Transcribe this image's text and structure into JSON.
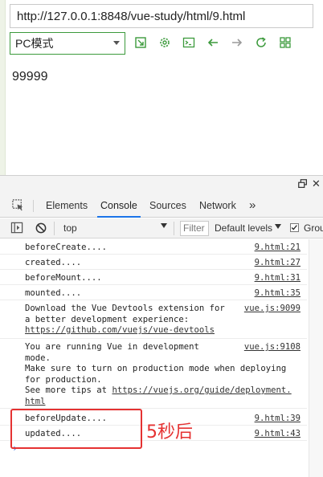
{
  "browser": {
    "url": "http://127.0.0.1:8848/vue-study/html/9.html",
    "mode_select": "PC模式",
    "toolbar_icons": [
      "screenshot-icon",
      "settings-icon",
      "console-icon",
      "back-icon",
      "forward-icon",
      "refresh-icon",
      "grid-icon"
    ],
    "accent": "#3c9a3c"
  },
  "page": {
    "text": "99999"
  },
  "devtools": {
    "tabs": [
      "Elements",
      "Console",
      "Sources",
      "Network"
    ],
    "active_tab": "Console",
    "more_tabs": "»",
    "context": "top",
    "filter_placeholder": "Filter",
    "levels": "Default levels",
    "group_label": "Grou"
  },
  "console": {
    "messages": [
      {
        "text": "beforeCreate....",
        "source": "9.html:21"
      },
      {
        "text": "created....",
        "source": "9.html:27"
      },
      {
        "text": "beforeMount....",
        "source": "9.html:31"
      },
      {
        "text": "mounted....",
        "source": "9.html:35"
      },
      {
        "line1": "Download the Vue Devtools extension for",
        "line2": "a better development experience:",
        "link": "https://github.com/vuejs/vue-devtools",
        "source": "vue.js:9099"
      },
      {
        "line1": "You are running Vue in development",
        "line2": "mode.",
        "line3": "Make sure to turn on production mode when deploying",
        "line4": "for production.",
        "line5_prefix": "See more tips at ",
        "link": "https://vuejs.org/guide/deployment.",
        "line6": "html",
        "source": "vue.js:9108"
      },
      {
        "text": "beforeUpdate....",
        "source": "9.html:39"
      },
      {
        "text": "updated....",
        "source": "9.html:43"
      }
    ],
    "prompt": "›"
  },
  "annotation": {
    "text": "5秒后",
    "color": "#e53232"
  }
}
